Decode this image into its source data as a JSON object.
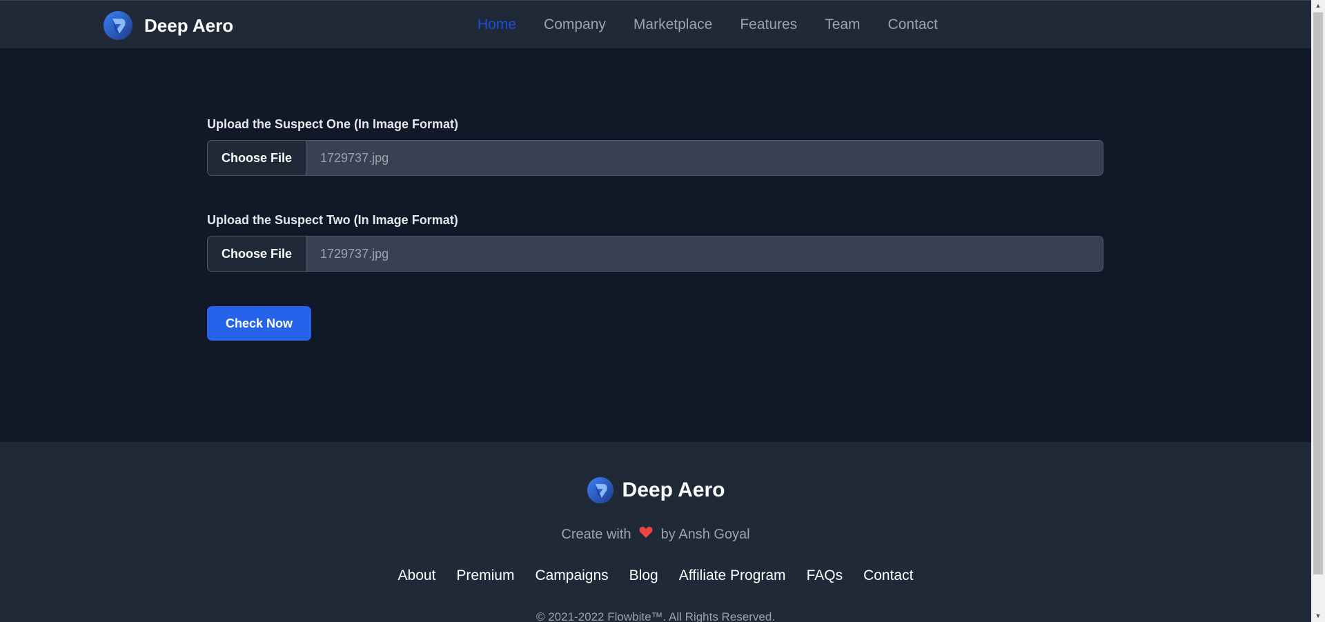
{
  "header": {
    "brand": "Deep Aero",
    "nav": [
      {
        "label": "Home",
        "active": true
      },
      {
        "label": "Company"
      },
      {
        "label": "Marketplace"
      },
      {
        "label": "Features"
      },
      {
        "label": "Team"
      },
      {
        "label": "Contact"
      }
    ]
  },
  "form": {
    "field1": {
      "label": "Upload the Suspect One (In Image Format)",
      "button": "Choose File",
      "filename": "1729737.jpg"
    },
    "field2": {
      "label": "Upload the Suspect Two (In Image Format)",
      "button": "Choose File",
      "filename": "1729737.jpg"
    },
    "submit": "Check Now"
  },
  "footer": {
    "brand": "Deep Aero",
    "tagline_before": "Create with",
    "tagline_after": "by Ansh Goyal",
    "links": [
      "About",
      "Premium",
      "Campaigns",
      "Blog",
      "Affiliate Program",
      "FAQs",
      "Contact"
    ],
    "copyright": "© 2021-2022 Flowbite™. All Rights Reserved."
  },
  "colors": {
    "background": "#111827",
    "surface": "#1f2937",
    "accent": "#2563eb",
    "nav_active": "#1d4ed8"
  },
  "icons": {
    "brand_logo": "logo-icon",
    "heart": "heart-icon"
  }
}
